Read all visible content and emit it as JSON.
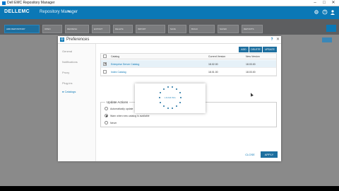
{
  "window": {
    "title": "Dell EMC Repository Manager",
    "minimize": "–",
    "maximize": "□",
    "close": "✕"
  },
  "header": {
    "brand": "DELLEMC",
    "product": "Repository Manager",
    "chevron": "▾"
  },
  "toolbar": {
    "primary_label": "ADD REPOSITORY",
    "buttons": [
      "OPEN",
      "REFRESH",
      "EXPORT",
      "DELETE",
      "IMPORT",
      "SAVE",
      "BUILD",
      "SAVED",
      "REPORTS"
    ]
  },
  "dialog": {
    "title": "Preferences",
    "help": "?",
    "close": "✕",
    "nav": [
      "General",
      "Notifications",
      "Proxy",
      "Plug-ins",
      "Catalogs"
    ],
    "active_nav": 4,
    "grid_buttons": [
      "ADD",
      "DELETE",
      "UPDATE"
    ],
    "columns": [
      "Catalog",
      "Current Version",
      "New Version"
    ],
    "rows": [
      {
        "checked": "✕",
        "catalog": "Enterprise Server Catalog",
        "current": "18.02.00",
        "new": "18.03.00"
      },
      {
        "checked": "",
        "catalog": "Index Catalog",
        "current": "18.01.00",
        "new": "18.03.00"
      }
    ],
    "update_actions": {
      "legend": "Update Actions",
      "options": [
        {
          "label": "Automatically update",
          "selected": false
        },
        {
          "label": "Warn when new catalog is available",
          "selected": true
        },
        {
          "label": "Never",
          "selected": false
        }
      ]
    },
    "close_button": "CLOSE",
    "apply_button": "APPLY"
  },
  "loader": {
    "label": "LOADING"
  }
}
